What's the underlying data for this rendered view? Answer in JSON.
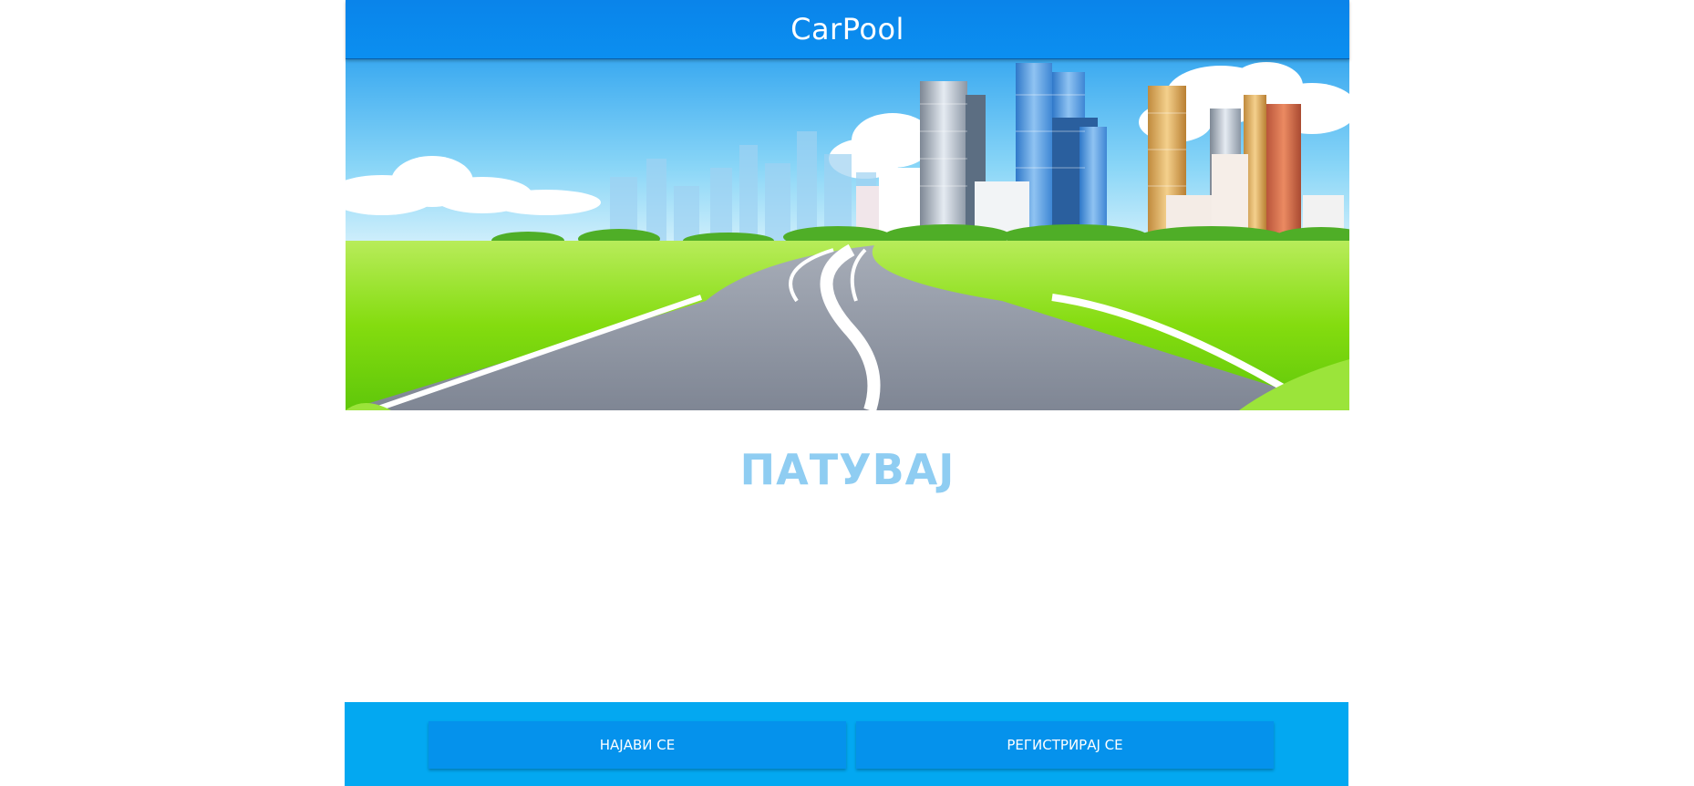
{
  "header": {
    "title": "CarPool"
  },
  "hero": {
    "image_name": "city-road-illustration"
  },
  "tagline": "ПАТУВАЈ",
  "footer": {
    "login_label": "НАЈАВИ СЕ",
    "register_label": "РЕГИСТРИРАЈ СЕ"
  },
  "colors": {
    "header": "#0a84ea",
    "footer": "#03a8f1",
    "button": "#0592ec",
    "tagline": "#8fcdf2"
  }
}
